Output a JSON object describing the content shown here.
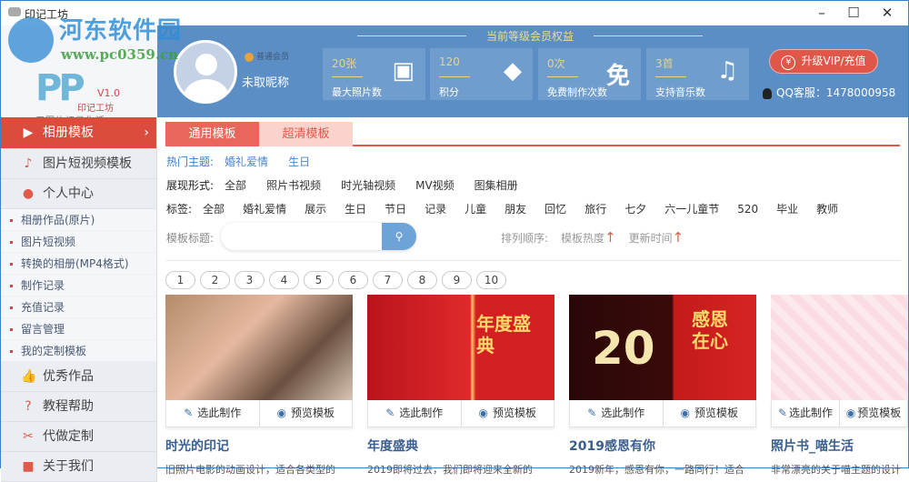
{
  "window": {
    "title": "印记工坊",
    "minimize": "–",
    "maximize": "☐",
    "close": "✕"
  },
  "watermark": {
    "name": "河东软件园",
    "url": "www.pc0359.cn"
  },
  "logo": {
    "mark": "PP",
    "version": "V1.0",
    "brand": "印记工坊",
    "slogan": "用图片记录生活"
  },
  "user": {
    "level": "普通会员",
    "nickname": "未取昵称"
  },
  "benefits": {
    "title": "当前等级会员权益",
    "items": [
      {
        "value": "20张",
        "label": "最大照片数",
        "icon": "image-icon",
        "glyph": "▣"
      },
      {
        "value": "120",
        "label": "积分",
        "icon": "coin-icon",
        "glyph": "◆"
      },
      {
        "value": "0次",
        "label": "免费制作次数",
        "icon": "free-icon",
        "glyph": "免"
      },
      {
        "value": "3首",
        "label": "支持音乐数",
        "icon": "music-icon",
        "glyph": "♫"
      }
    ]
  },
  "vip_button": "升级VIP/充值",
  "vip_icon": "¥",
  "qq": "QQ客服：1478000958",
  "sidebar": {
    "items": [
      {
        "label": "相册模板",
        "glyph": "▶"
      },
      {
        "label": "图片短视频模板",
        "glyph": "♪"
      },
      {
        "label": "个人中心",
        "glyph": "●"
      }
    ],
    "sub": [
      "相册作品(原片)",
      "图片短视频",
      "转换的相册(MP4格式)",
      "制作记录",
      "充值记录",
      "留言管理",
      "我的定制模板"
    ],
    "bottom": [
      {
        "label": "优秀作品",
        "glyph": "👍"
      },
      {
        "label": "教程帮助",
        "glyph": "?"
      },
      {
        "label": "代做定制",
        "glyph": "✂"
      },
      {
        "label": "关于我们",
        "glyph": "■"
      }
    ]
  },
  "tabs": [
    "通用模板",
    "超清模板"
  ],
  "hot": {
    "label": "热门主题:",
    "items": [
      "婚礼爱情",
      "生日"
    ]
  },
  "format": {
    "label": "展现形式:",
    "items": [
      "全部",
      "照片书视频",
      "时光轴视频",
      "MV视频",
      "图集相册"
    ]
  },
  "tags": {
    "label": "标签:",
    "items": [
      "全部",
      "婚礼爱情",
      "展示",
      "生日",
      "节日",
      "记录",
      "儿童",
      "朋友",
      "回忆",
      "旅行",
      "七夕",
      "六一儿童节",
      "520",
      "毕业",
      "教师"
    ]
  },
  "search": {
    "label": "模板标题:",
    "placeholder": ""
  },
  "sort": {
    "label": "排列顺序:",
    "items": [
      "模板热度",
      "更新时间"
    ],
    "arrow": "↑"
  },
  "pages": [
    "1",
    "2",
    "3",
    "4",
    "5",
    "6",
    "7",
    "8",
    "9",
    "10"
  ],
  "card_actions": {
    "make": "选此制作",
    "preview": "预览模板"
  },
  "cards": [
    {
      "title": "时光的印记",
      "desc": "旧照片电影的动画设计，适合各类型的"
    },
    {
      "title": "年度盛典",
      "desc": "2019即将过去，我们即将迎来全新的",
      "img_text": "年度盛典"
    },
    {
      "title": "2019感恩有你",
      "desc": "2019新年，感恩有你，一路同行！适合",
      "img_text": "20",
      "img_text2": "感恩在心"
    },
    {
      "title": "照片书_喵生活",
      "desc": "非常漂亮的关于喵主题的设计"
    }
  ]
}
